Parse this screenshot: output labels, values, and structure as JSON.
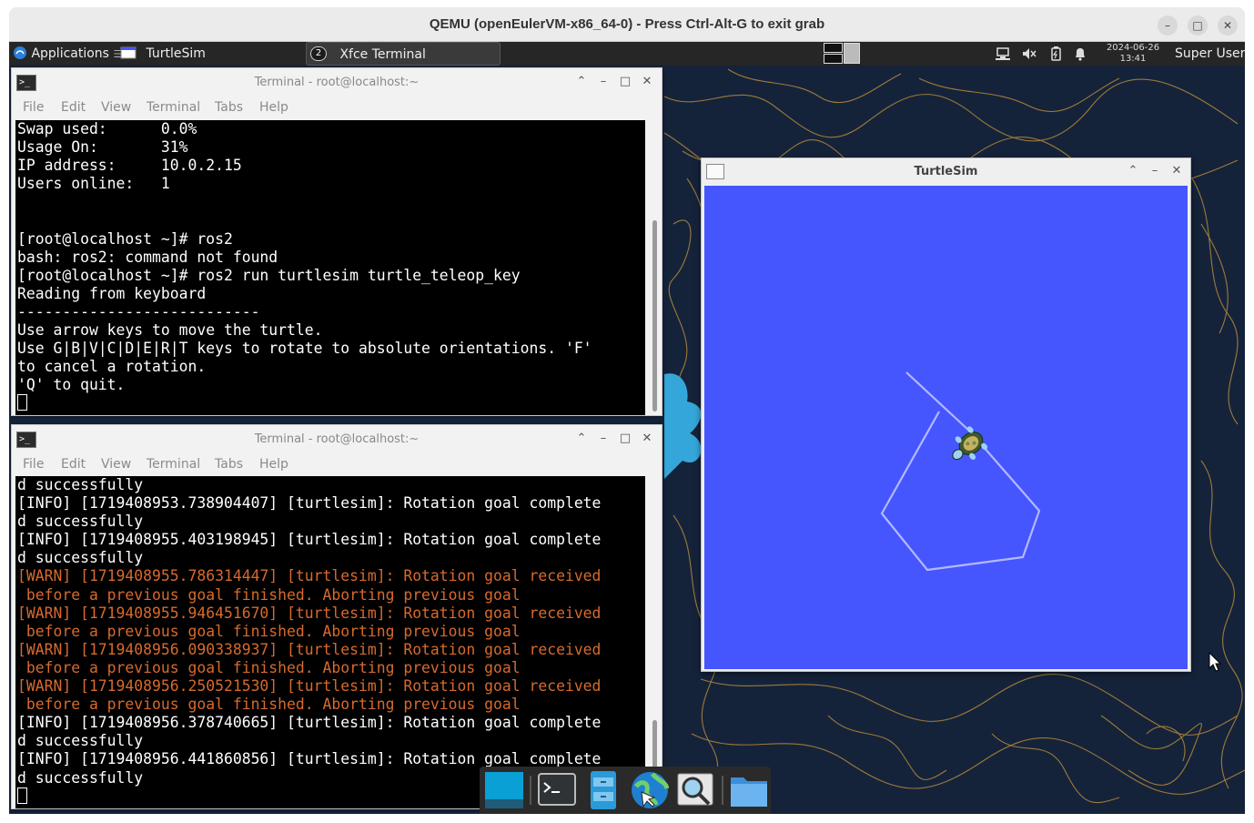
{
  "host_window": {
    "title": "QEMU (openEulerVM-x86_64-0) - Press Ctrl-Alt-G to exit grab",
    "minimize_symbol": "–",
    "maximize_symbol": "□",
    "close_symbol": "✕"
  },
  "panel": {
    "applications_label": "Applications",
    "applications_separator": "☰",
    "tasks": [
      {
        "label": "TurtleSim",
        "icon": "turtlesim-window-icon"
      },
      {
        "label": "Xfce Terminal",
        "icon": "terminal-group-icon",
        "count": "2"
      }
    ],
    "tray_icons": [
      "network-icon",
      "volume-muted-icon",
      "battery-icon",
      "notification-bell-icon"
    ],
    "clock_date": "2024-06-26",
    "clock_time": "13:41",
    "user": "Super User"
  },
  "terminal_menu": [
    "File",
    "Edit",
    "View",
    "Terminal",
    "Tabs",
    "Help"
  ],
  "terminal_top": {
    "title": "Terminal - root@localhost:~",
    "lines": [
      {
        "text": "Swap used:      0.0%"
      },
      {
        "text": "Usage On:       31%"
      },
      {
        "text": "IP address:     10.0.2.15"
      },
      {
        "text": "Users online:   1"
      },
      {
        "text": ""
      },
      {
        "text": ""
      },
      {
        "text": "[root@localhost ~]# ros2"
      },
      {
        "text": "bash: ros2: command not found"
      },
      {
        "text": "[root@localhost ~]# ros2 run turtlesim turtle_teleop_key"
      },
      {
        "text": "Reading from keyboard"
      },
      {
        "text": "---------------------------"
      },
      {
        "text": "Use arrow keys to move the turtle."
      },
      {
        "text": "Use G|B|V|C|D|E|R|T keys to rotate to absolute orientations. 'F'"
      },
      {
        "text": "to cancel a rotation."
      },
      {
        "text": "'Q' to quit."
      }
    ]
  },
  "terminal_bottom": {
    "title": "Terminal - root@localhost:~",
    "lines": [
      {
        "text": "d successfully",
        "level": "info"
      },
      {
        "text": "[INFO] [1719408953.738904407] [turtlesim]: Rotation goal complete",
        "level": "info"
      },
      {
        "text": "d successfully",
        "level": "info"
      },
      {
        "text": "[INFO] [1719408955.403198945] [turtlesim]: Rotation goal complete",
        "level": "info"
      },
      {
        "text": "d successfully",
        "level": "info"
      },
      {
        "text": "[WARN] [1719408955.786314447] [turtlesim]: Rotation goal received",
        "level": "warn"
      },
      {
        "text": " before a previous goal finished. Aborting previous goal",
        "level": "warn"
      },
      {
        "text": "[WARN] [1719408955.946451670] [turtlesim]: Rotation goal received",
        "level": "warn"
      },
      {
        "text": " before a previous goal finished. Aborting previous goal",
        "level": "warn"
      },
      {
        "text": "[WARN] [1719408956.090338937] [turtlesim]: Rotation goal received",
        "level": "warn"
      },
      {
        "text": " before a previous goal finished. Aborting previous goal",
        "level": "warn"
      },
      {
        "text": "[WARN] [1719408956.250521530] [turtlesim]: Rotation goal received",
        "level": "warn"
      },
      {
        "text": " before a previous goal finished. Aborting previous goal",
        "level": "warn"
      },
      {
        "text": "[INFO] [1719408956.378740665] [turtlesim]: Rotation goal complete",
        "level": "info"
      },
      {
        "text": "d successfully",
        "level": "info"
      },
      {
        "text": "[INFO] [1719408956.441860856] [turtlesim]: Rotation goal complete",
        "level": "info"
      },
      {
        "text": "d successfully",
        "level": "info"
      }
    ]
  },
  "turtlesim": {
    "title": "TurtleSim",
    "background_color": "#4556ff",
    "path_color": "#b3b8ff"
  },
  "dock": {
    "items": [
      "show-desktop-icon",
      "terminal-icon",
      "file-manager-icon",
      "web-browser-icon",
      "app-finder-icon",
      "folder-icon"
    ]
  },
  "colors": {
    "warn_text": "#d76a2c",
    "panel_bg": "#262626",
    "wallpaper_bg": "#15233a",
    "wallpaper_lines": "#b5893a"
  }
}
